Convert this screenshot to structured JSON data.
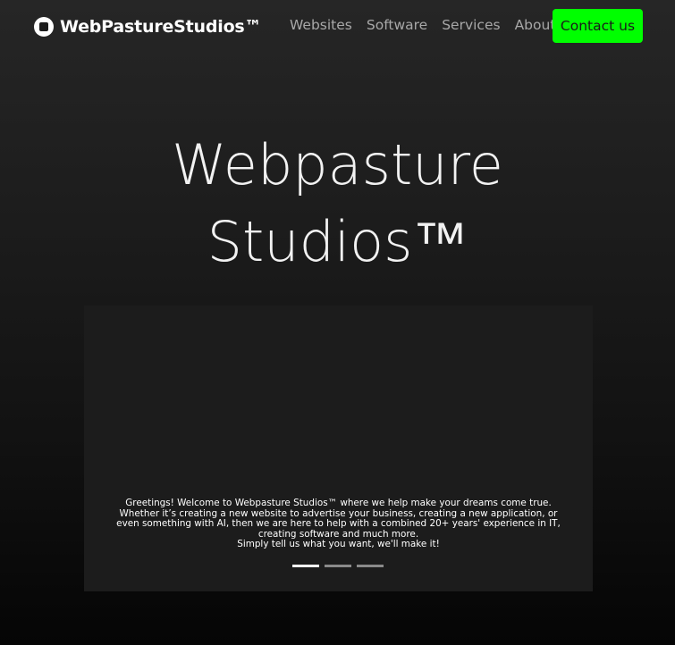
{
  "navbar": {
    "brand": {
      "logo_icon": "stop-circle-icon",
      "name": "WebPastureStudios™"
    },
    "links": [
      {
        "label": "Websites"
      },
      {
        "label": "Software"
      },
      {
        "label": "Services"
      },
      {
        "label": "About"
      }
    ],
    "contact_button": {
      "label": "Contact us",
      "color": "#00ff00"
    }
  },
  "hero": {
    "title_line1": "Webpasture",
    "title_line2": "Studios™"
  },
  "carousel": {
    "caption_lines": [
      "Greetings! Welcome to Webpasture Studios™ where we help make your dreams come true.",
      "Whether it’s creating a new website to advertise your business, creating a new application, or",
      "even something with AI, then we are here to help with a combined 20+ years' experience in IT,",
      "creating software and much more.",
      "Simply tell us what you want, we'll make it!"
    ],
    "slide_count": 3,
    "active_slide": 1
  },
  "colors": {
    "accent": "#00ff00",
    "background_top": "#262626",
    "background_bottom": "#050505",
    "nav_link": "#a8a8a8"
  }
}
